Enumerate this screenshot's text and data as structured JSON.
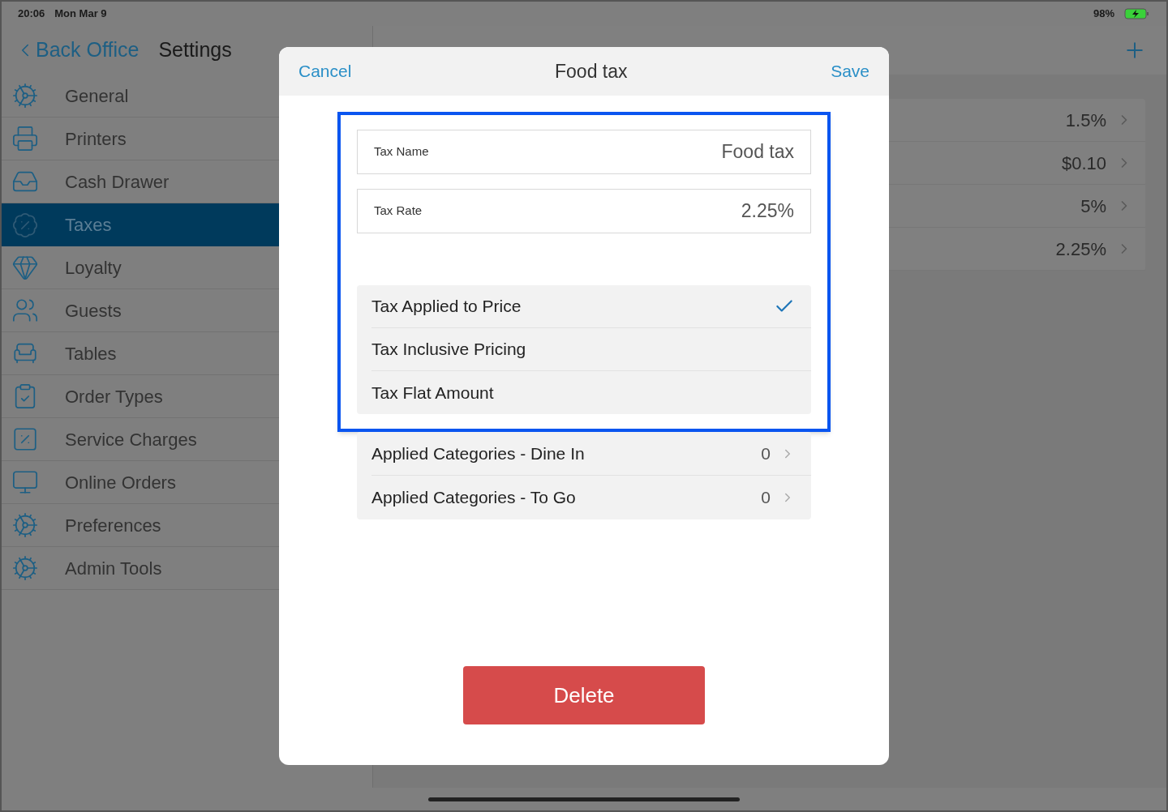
{
  "status_bar": {
    "time": "20:06",
    "date": "Mon Mar 9",
    "battery": "98%"
  },
  "sidebar": {
    "back": "Back Office",
    "title": "Settings",
    "items": [
      {
        "label": "General",
        "selected": false
      },
      {
        "label": "Printers",
        "selected": false
      },
      {
        "label": "Cash Drawer",
        "selected": false
      },
      {
        "label": "Taxes",
        "selected": true
      },
      {
        "label": "Loyalty",
        "selected": false
      },
      {
        "label": "Guests",
        "selected": false
      },
      {
        "label": "Tables",
        "selected": false
      },
      {
        "label": "Order Types",
        "selected": false
      },
      {
        "label": "Service Charges",
        "selected": false
      },
      {
        "label": "Online Orders",
        "selected": false
      },
      {
        "label": "Preferences",
        "selected": false
      },
      {
        "label": "Admin Tools",
        "selected": false
      }
    ]
  },
  "tax_list": {
    "rows": [
      "1.5%",
      "$0.10",
      "5%",
      "2.25%"
    ]
  },
  "dialog": {
    "cancel": "Cancel",
    "title": "Food tax",
    "save": "Save",
    "fields": [
      {
        "label": "Tax Name",
        "value": "Food tax"
      },
      {
        "label": "Tax Rate",
        "value": "2.25%"
      }
    ],
    "options": [
      {
        "label": "Tax Applied to Price",
        "selected": true
      },
      {
        "label": "Tax Inclusive Pricing",
        "selected": false
      },
      {
        "label": "Tax Flat Amount",
        "selected": false
      }
    ],
    "categories": [
      {
        "label": "Applied Categories - Dine In",
        "count": "0"
      },
      {
        "label": "Applied Categories - To Go",
        "count": "0"
      }
    ],
    "delete": "Delete"
  }
}
